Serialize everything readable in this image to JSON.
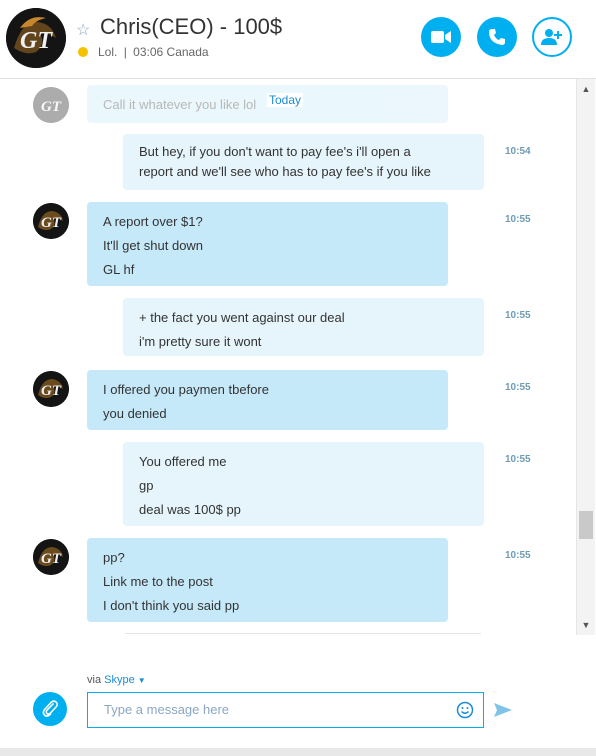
{
  "header": {
    "title": "Chris(CEO) - 100$",
    "mood": "Lol.",
    "separator": "|",
    "local_time": "03:06 Canada",
    "accent_color": "#00aff0"
  },
  "chat": {
    "date_divider": "Today",
    "faded_message": "Call it whatever you like lol",
    "messages": [
      {
        "from": "me",
        "time": "10:54",
        "lines": [
          "But hey, if you don't want to pay fee's i'll open a",
          "report and we'll see who has to pay fee's if you like"
        ]
      },
      {
        "from": "them",
        "time": "10:55",
        "lines": [
          "A report over $1?",
          "It'll get shut down",
          "GL hf"
        ]
      },
      {
        "from": "me",
        "time": "10:55",
        "lines": [
          "+ the fact you went against our deal",
          "i'm pretty sure it wont"
        ]
      },
      {
        "from": "them",
        "time": "10:55",
        "lines": [
          "I offered you paymen tbefore",
          "you denied"
        ]
      },
      {
        "from": "me",
        "time": "10:55",
        "lines": [
          "You offered me",
          "gp",
          "deal was 100$ pp"
        ]
      },
      {
        "from": "them",
        "time": "10:55",
        "lines": [
          "pp?",
          "Link me to the post",
          "I don't think you said pp"
        ]
      }
    ]
  },
  "footer": {
    "via_label": "via",
    "via_service": "Skype",
    "placeholder": "Type a message here"
  }
}
